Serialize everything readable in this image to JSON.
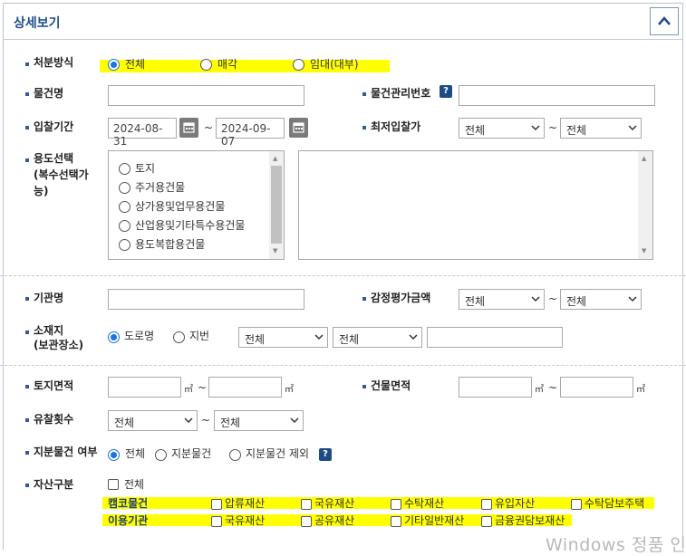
{
  "panel": {
    "title": "상세보기",
    "collapse_icon": "chevron-up-icon"
  },
  "disposal": {
    "label": "처분방식",
    "options": [
      "전체",
      "매각",
      "임대(대부)"
    ],
    "selected": "전체"
  },
  "item_name": {
    "label": "물건명",
    "value": ""
  },
  "item_mgmt_no": {
    "label": "물건관리번호",
    "help": "?",
    "value": ""
  },
  "bid_period": {
    "label": "입찰기간",
    "start": "2024-08-31",
    "end": "2024-09-07",
    "sep": "~"
  },
  "min_bid": {
    "label": "최저입찰가",
    "from": "전체",
    "to": "전체",
    "sep": "~"
  },
  "usage": {
    "label": "용도선택\n(복수선택가능)",
    "label_lines": [
      "용도선택",
      "(복수선택가",
      "능)"
    ],
    "options": [
      "토지",
      "주거용건물",
      "상가용및업무용건물",
      "산업용및기타특수용건물",
      "용도복합용건물"
    ]
  },
  "agency": {
    "label": "기관명",
    "value": ""
  },
  "appraisal": {
    "label": "감정평가금액",
    "from": "전체",
    "to": "전체",
    "sep": "~"
  },
  "location": {
    "label_lines": [
      "소재지",
      "(보관장소)"
    ],
    "options": [
      "도로명",
      "지번"
    ],
    "selected": "도로명",
    "select1": "전체",
    "select2": "전체",
    "detail": ""
  },
  "land_area": {
    "label": "토지면적",
    "unit": "㎡",
    "sep": "~"
  },
  "building_area": {
    "label": "건물면적",
    "unit": "㎡",
    "sep": "~"
  },
  "failed_count": {
    "label": "유찰횟수",
    "from": "전체",
    "to": "전체",
    "sep": "~"
  },
  "share": {
    "label": "지분물건 여부",
    "options": [
      "전체",
      "지분물건",
      "지분물건 제외"
    ],
    "selected": "전체",
    "help": "?"
  },
  "asset": {
    "label": "자산구분",
    "all_label": "전체",
    "group1_label": "캠코물건",
    "group1": [
      "압류재산",
      "국유재산",
      "수탁재산",
      "유입자산",
      "수탁담보주택"
    ],
    "group2_label": "이용기관",
    "group2": [
      "국유재산",
      "공유재산",
      "기타일반재산",
      "금융권담보재산"
    ]
  },
  "watermark": "Windows 정품 인",
  "colors": {
    "highlight": "#ffff00",
    "title": "#1f4e8c",
    "radio_selected": "#1a73e8",
    "help_bg": "#1d4b85"
  }
}
